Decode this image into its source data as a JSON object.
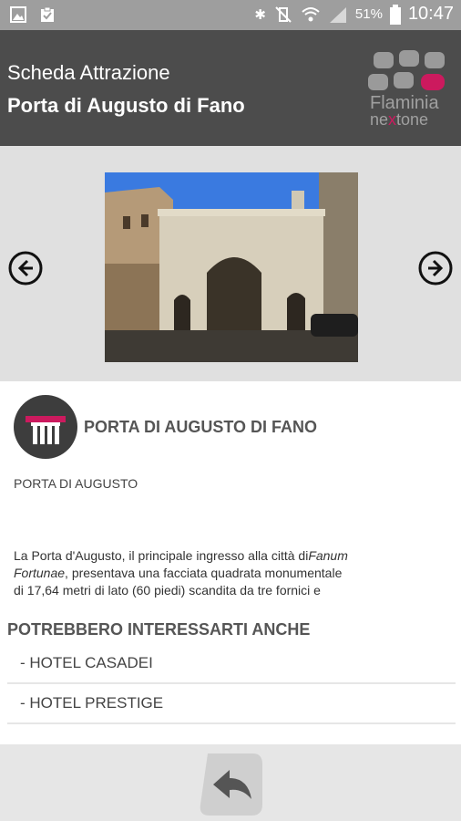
{
  "status_bar": {
    "battery": "51%",
    "time": "10:47",
    "left_icons": [
      "image-icon",
      "clipboard-check-icon"
    ],
    "right_icons": [
      "bluetooth-icon",
      "vibrate-mute-icon",
      "wifi-icon",
      "signal-icon",
      "battery-icon"
    ]
  },
  "app_bar": {
    "subtitle": "Scheda Attrazione",
    "title": "Porta di Augusto di Fano",
    "logo_text": "Flaminia nextone"
  },
  "carousel": {
    "image_desc": "photo-porta-di-augusto",
    "prev_icon": "arrow-left-circle-icon",
    "next_icon": "arrow-right-circle-icon"
  },
  "attraction": {
    "icon": "column-monument-icon",
    "name": "PORTA DI AUGUSTO DI FANO",
    "type": "PORTA DI AUGUSTO",
    "description_line1_a": "La Porta d'Augusto, il principale ingresso alla città di",
    "description_line1_b": "Fanum",
    "description_line2_a": "Fortunae",
    "description_line2_b": ", presentava una facciata quadrata monumentale",
    "description_line3": "di 17,64 metri di lato (60 piedi) scandita da tre fornici e"
  },
  "related": {
    "heading": "POTREBBERO INTERESSARTI ANCHE",
    "items": [
      {
        "label": "- HOTEL CASADEI"
      },
      {
        "label": "- HOTEL PRESTIGE"
      }
    ]
  },
  "bottom_bar": {
    "back_icon": "reply-back-icon"
  },
  "colors": {
    "status_bar": "#9e9e9e",
    "app_bar": "#4c4c4c",
    "carousel_bg": "#e0e0e0",
    "logo_accent": "#cc1a5e",
    "bottom_bar": "#e6e6e6"
  }
}
